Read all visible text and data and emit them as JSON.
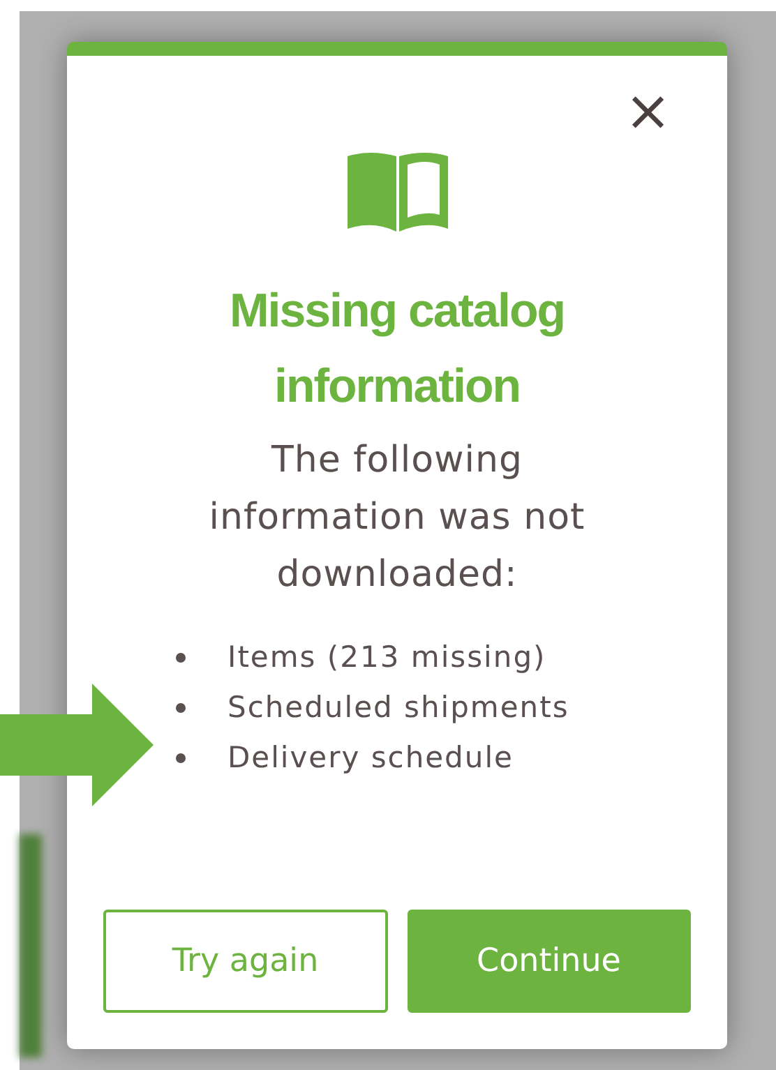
{
  "dialog": {
    "close_label": "×",
    "title": "Missing catalog information",
    "message": "The following information was not downloaded:",
    "items": [
      "Items (213 missing)",
      "Scheduled shipments",
      "Delivery schedule"
    ],
    "buttons": [
      {
        "label": "Try again",
        "kind": "secondary"
      },
      {
        "label": "Continue",
        "kind": "primary"
      }
    ]
  }
}
